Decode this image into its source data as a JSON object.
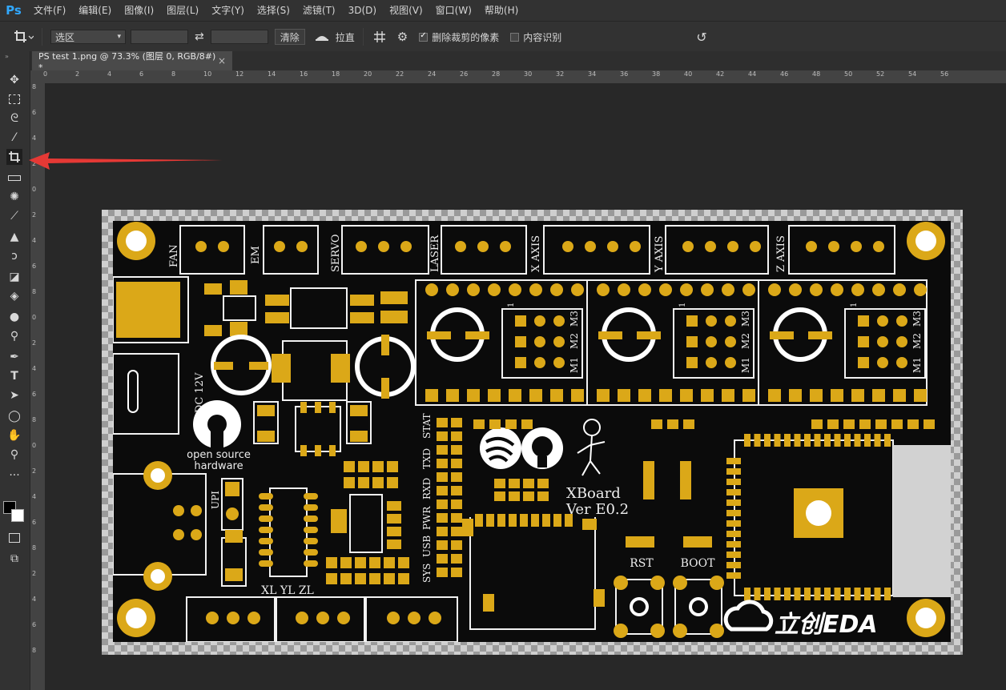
{
  "app": {
    "logo": "Ps"
  },
  "menu": [
    "文件(F)",
    "编辑(E)",
    "图像(I)",
    "图层(L)",
    "文字(Y)",
    "选择(S)",
    "滤镜(T)",
    "3D(D)",
    "视图(V)",
    "窗口(W)",
    "帮助(H)"
  ],
  "options": {
    "mode_select": "选区",
    "clear_label": "清除",
    "straighten_label": "拉直",
    "delete_cropped_label": "删除裁剪的像素",
    "delete_cropped_checked": true,
    "content_aware_label": "内容识别",
    "content_aware_checked": false
  },
  "tab": {
    "title": "PS test 1.png @ 73.3% (图层 0, RGB/8#) *",
    "close": "×"
  },
  "ruler_h": [
    "0",
    "2",
    "4",
    "6",
    "8",
    "10",
    "12",
    "14",
    "16",
    "18",
    "20",
    "22",
    "24",
    "26",
    "28",
    "30",
    "32",
    "34",
    "36",
    "38",
    "40",
    "42",
    "44",
    "46",
    "48",
    "50",
    "52",
    "54",
    "56"
  ],
  "ruler_v": [
    "8",
    "6",
    "4",
    "2",
    "0",
    "2",
    "4",
    "6",
    "8",
    "0",
    "2",
    "4",
    "6",
    "8",
    "0",
    "2",
    "4",
    "6",
    "8",
    "2",
    "4",
    "6",
    "8"
  ],
  "pcb_labels": {
    "fan": "FAN",
    "em": "EM",
    "servo": "SERVO",
    "laser": "LASER",
    "x_axis": "X AXIS",
    "y_axis": "Y AXIS",
    "z_axis": "Z AXIS",
    "dc": "DC 12V",
    "osh1": "open source",
    "osh2": "hardware",
    "upi": "UPI",
    "xyz": "XL YL ZL",
    "stat": "STAT",
    "txd": "TXD",
    "rxd": "RXD",
    "pwr": "PWR",
    "usb": "USB",
    "sys": "SYS",
    "board1": "XBoard",
    "board2": "Ver E0.2",
    "rst": "RST",
    "boot": "BOOT",
    "brand": "立创EDA",
    "m1": "M1",
    "m2": "M2",
    "m3": "M3",
    "one": "1"
  },
  "colors": {
    "gold": "#dba818",
    "pcb": "#0b0b0b",
    "silk": "#f2f2f2",
    "arrow": "#e53935"
  }
}
